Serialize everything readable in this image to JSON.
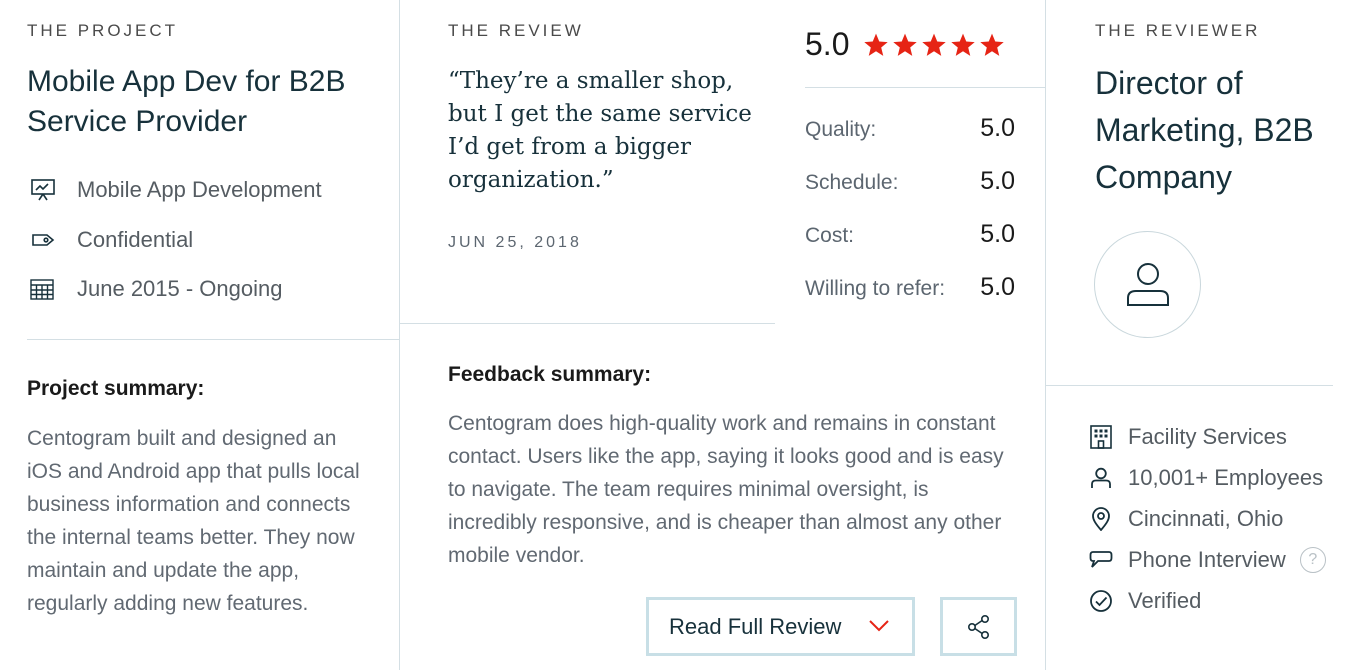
{
  "project": {
    "eyebrow": "THE PROJECT",
    "title": "Mobile App Dev for B2B Service Provider",
    "meta": [
      {
        "icon": "presentation-board-icon",
        "text": "Mobile App Development"
      },
      {
        "icon": "price-tag-icon",
        "text": "Confidential"
      },
      {
        "icon": "calendar-icon",
        "text": "June 2015 - Ongoing"
      }
    ],
    "summary_label": "Project summary:",
    "summary_text": "Centogram built and designed an iOS and Android app that pulls local business information and connects the internal teams better. They now maintain and update the app, regularly adding new features."
  },
  "review": {
    "eyebrow": "THE REVIEW",
    "quote": "“They’re a smaller shop, but I get the same service I’d get from a bigger organization.”",
    "date": "JUN 25, 2018",
    "overall": "5.0",
    "stars": 5,
    "star_color": "#e62415",
    "scores": [
      {
        "label": "Quality:",
        "value": "5.0"
      },
      {
        "label": "Schedule:",
        "value": "5.0"
      },
      {
        "label": "Cost:",
        "value": "5.0"
      },
      {
        "label": "Willing to refer:",
        "value": "5.0"
      }
    ],
    "feedback_label": "Feedback summary:",
    "feedback_text": "Centogram does high-quality work and remains in constant contact. Users like the app, saying it looks good and is easy to navigate. The team requires minimal oversight, is incredibly responsive, and is cheaper than almost any other mobile vendor.",
    "read_full_label": "Read Full Review"
  },
  "reviewer": {
    "eyebrow": "THE REVIEWER",
    "title": "Director of Marketing, B2B Company",
    "details": [
      {
        "icon": "building-icon",
        "text": "Facility Services"
      },
      {
        "icon": "person-icon",
        "text": "10,001+ Employees"
      },
      {
        "icon": "location-pin-icon",
        "text": "Cincinnati, Ohio"
      },
      {
        "icon": "speech-bubble-icon",
        "text": "Phone Interview"
      },
      {
        "icon": "check-circle-icon",
        "text": "Verified"
      }
    ],
    "help_glyph": "?"
  },
  "colors": {
    "accent_red": "#e62415",
    "navy": "#17313b",
    "border": "#c8dfe6"
  }
}
